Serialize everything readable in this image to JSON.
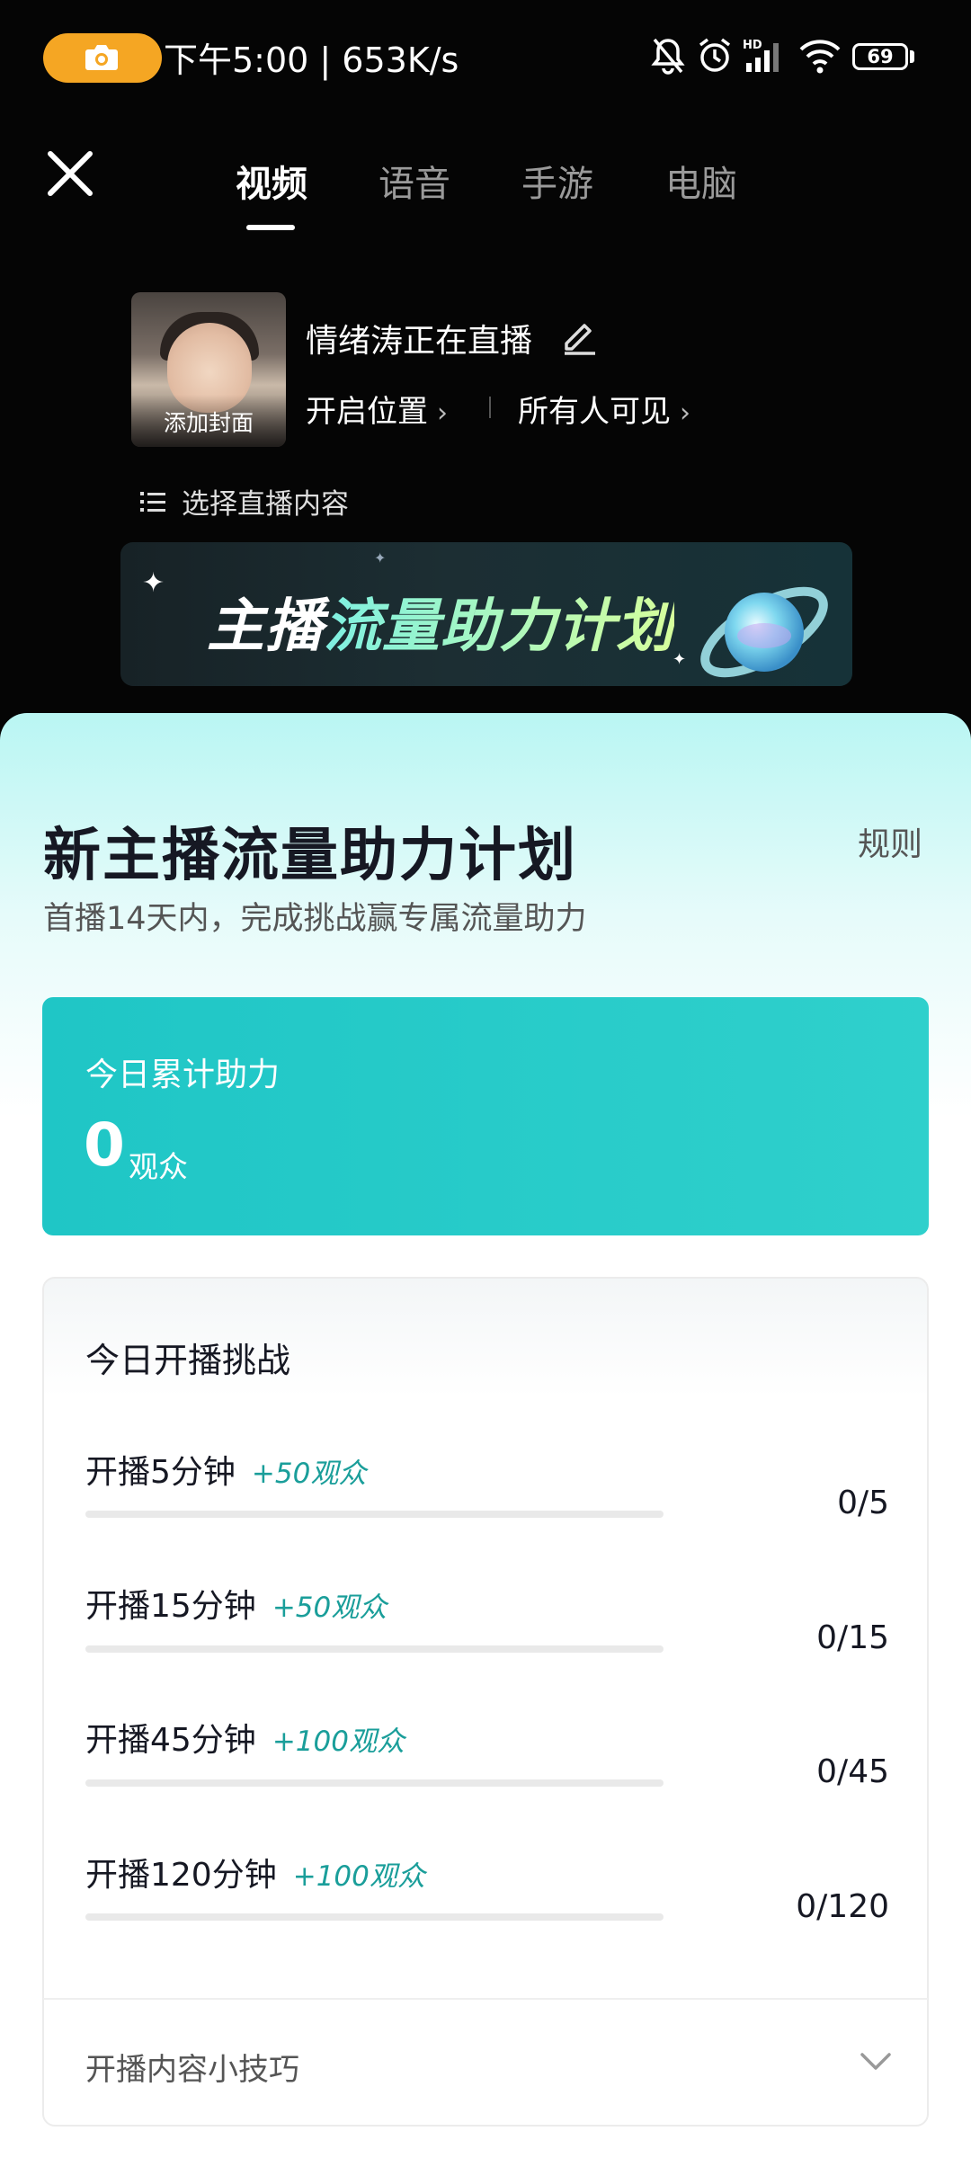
{
  "status_bar": {
    "time": "下午5:00 | 653K/s",
    "battery": "69",
    "icons": [
      "camera-icon",
      "mute-bell-icon",
      "alarm-icon",
      "hd-signal-icon",
      "wifi-icon",
      "battery-icon"
    ]
  },
  "tabs": [
    {
      "label": "视频",
      "active": true
    },
    {
      "label": "语音",
      "active": false
    },
    {
      "label": "手游",
      "active": false
    },
    {
      "label": "电脑",
      "active": false
    }
  ],
  "cover": {
    "label": "添加封面"
  },
  "live": {
    "title": "情绪涛正在直播",
    "location": "开启位置",
    "privacy": "所有人可见",
    "content_select": "选择直播内容"
  },
  "banner": {
    "text_white": "主播",
    "text_green": "流量助力计划"
  },
  "sheet": {
    "title": "新主播流量助力计划",
    "rules": "规则",
    "subtitle": "首播14天内，完成挑战赢专属流量助力",
    "total": {
      "label": "今日累计助力",
      "value": "0",
      "unit": "观众"
    },
    "challenge": {
      "title": "今日开播挑战",
      "tasks": [
        {
          "label": "开播5分钟",
          "reward": "+50观众",
          "count": "0/5",
          "progress": 0
        },
        {
          "label": "开播15分钟",
          "reward": "+50观众",
          "count": "0/15",
          "progress": 0
        },
        {
          "label": "开播45分钟",
          "reward": "+100观众",
          "count": "0/45",
          "progress": 0
        },
        {
          "label": "开播120分钟",
          "reward": "+100观众",
          "count": "0/120",
          "progress": 0
        }
      ]
    },
    "tips": "开播内容小技巧"
  },
  "colors": {
    "accent": "#1fc6c6",
    "reward_text": "#1a9e9a",
    "camera_pill": "#f5a623"
  }
}
